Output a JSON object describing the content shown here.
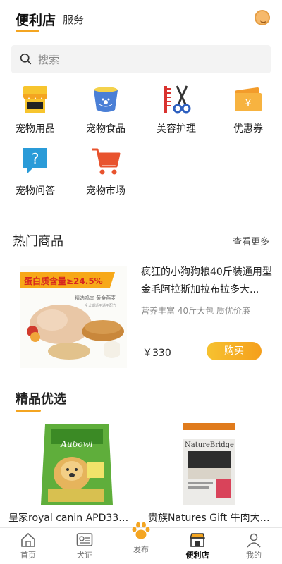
{
  "header": {
    "active_tab": "便利店",
    "other_tab": "服务"
  },
  "search": {
    "placeholder": "搜索"
  },
  "categories": [
    {
      "label": "宠物用品",
      "icon": "shop-icon"
    },
    {
      "label": "宠物食品",
      "icon": "pet-bowl-icon"
    },
    {
      "label": "美容护理",
      "icon": "scissors-comb-icon"
    },
    {
      "label": "优惠券",
      "icon": "coupon-icon"
    },
    {
      "label": "宠物问答",
      "icon": "question-chat-icon"
    },
    {
      "label": "宠物市场",
      "icon": "cart-icon"
    }
  ],
  "hot": {
    "title": "热门商品",
    "more": "查看更多",
    "product": {
      "title": "疯狂的小狗狗粮40斤装通用型金毛阿拉斯加拉布拉多大...",
      "subtitle": "营养丰富 40斤大包 质优价廉",
      "price": "￥330",
      "buy": "购买",
      "image_text_protein": "蛋白质含量≥24.5%",
      "image_text_line1": "精选鸡肉 黄金燕麦",
      "image_text_line2": "全犬期适用通用配方"
    }
  },
  "featured": {
    "title": "精品优选",
    "items": [
      {
        "name": "皇家royal canin APD33泰...",
        "brand_text": "Aubowl"
      },
      {
        "name": "贵族Natures Gift 牛肉大米...",
        "brand_text": "NatureBridge"
      }
    ]
  },
  "nav": [
    {
      "label": "首页",
      "icon": "home-icon"
    },
    {
      "label": "犬证",
      "icon": "dog-license-icon"
    },
    {
      "label": "发布",
      "icon": "paw-icon"
    },
    {
      "label": "便利店",
      "icon": "store-icon",
      "active": true
    },
    {
      "label": "我的",
      "icon": "user-icon"
    }
  ],
  "colors": {
    "accent": "#f4a521",
    "buy_start": "#f6c230",
    "buy_end": "#f59f1c"
  }
}
